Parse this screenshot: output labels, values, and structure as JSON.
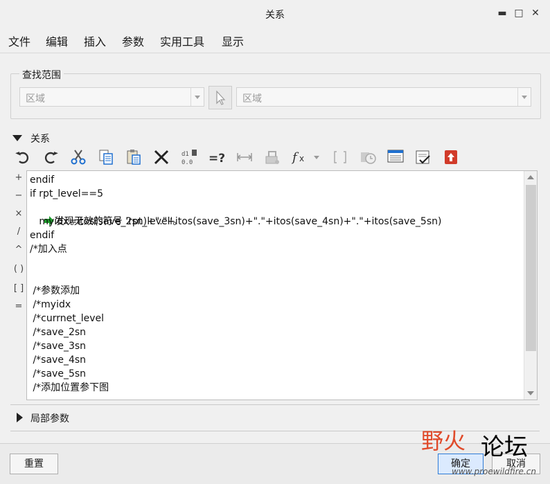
{
  "window": {
    "title": "关系",
    "controls": {
      "minimize": "▬",
      "maximize": "□",
      "close": "✕"
    }
  },
  "menu": [
    "文件",
    "编辑",
    "插入",
    "参数",
    "实用工具",
    "显示"
  ],
  "find_scope": {
    "label": "查找范围",
    "left_combo": "区域",
    "right_combo": "区域"
  },
  "relations": {
    "label": "关系",
    "toolbar_icons": [
      "undo-icon",
      "redo-icon",
      "cut-icon",
      "copy-icon",
      "paste-icon",
      "delete-icon",
      "number-format-icon",
      "evaluate-icon",
      "dimension-icon",
      "clamp-icon",
      "function-icon",
      "bracket-icon",
      "timer-icon",
      "display-icon",
      "verify-icon",
      "export-icon"
    ],
    "operators": [
      "+",
      "−",
      "×",
      "/",
      "^",
      "( )",
      "[ ]",
      "="
    ],
    "code": [
      "endif",
      "if rpt_level==5",
      "发现无效的符号 'rpt_level'。",
      "   myidx=itos(save_2sn)+\".\"+itos(save_3sn)+\".\"+itos(save_4sn)+\".\"+itos(save_5sn)",
      "endif",
      "/*加入点",
      "",
      "",
      " /*参数添加",
      " /*myidx",
      " /*currnet_level",
      " /*save_2sn",
      " /*save_3sn",
      " /*save_4sn",
      " /*save_5sn",
      " /*添加位置参下图"
    ]
  },
  "local_params": {
    "label": "局部参数"
  },
  "buttons": {
    "reset": "重置",
    "ok": "确定",
    "cancel": "取消"
  },
  "watermark": {
    "brand_left": "野火",
    "brand_right": "论坛",
    "url": "www.proewildfire.cn"
  },
  "colors": {
    "accent": "#2e7bd6",
    "error_arrow": "#1b9a2a",
    "watermark_red": "#e04a2a"
  }
}
